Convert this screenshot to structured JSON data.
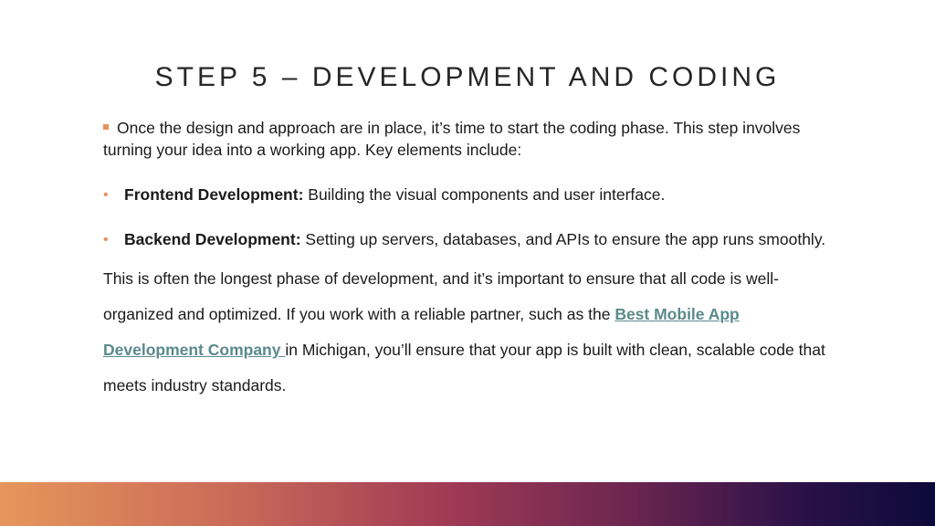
{
  "slide": {
    "title": "STEP 5 – DEVELOPMENT AND CODING",
    "intro": "Once the design and approach are in place, it’s time to start the coding phase. This step involves turning your idea into a working app. Key elements include:",
    "bullets": [
      {
        "term": "Frontend Development:",
        "text": " Building the visual components and user interface."
      },
      {
        "term": "Backend Development:",
        "text": " Setting up servers, databases, and APIs to ensure the app runs smoothly."
      }
    ],
    "closing": {
      "before": "This is often the longest phase of development, and it’s important to ensure that all code is well-organized and optimized. If you work with a reliable partner, such as the ",
      "link": "Best Mobile App Development Company ",
      "after": "in Michigan, you’ll ensure that your app is built with clean, scalable code that meets industry standards."
    }
  },
  "colors": {
    "bullet_accent": "#e8925c",
    "link": "#5b8a8c",
    "footer_gradient": [
      "#e6965c",
      "#c96a58",
      "#a03a55",
      "#6a2550",
      "#2a1148",
      "#0c0a3a"
    ]
  },
  "icons": {
    "intro_bullet": "square-bullet-icon",
    "list_bullet": "dot-bullet-icon"
  }
}
